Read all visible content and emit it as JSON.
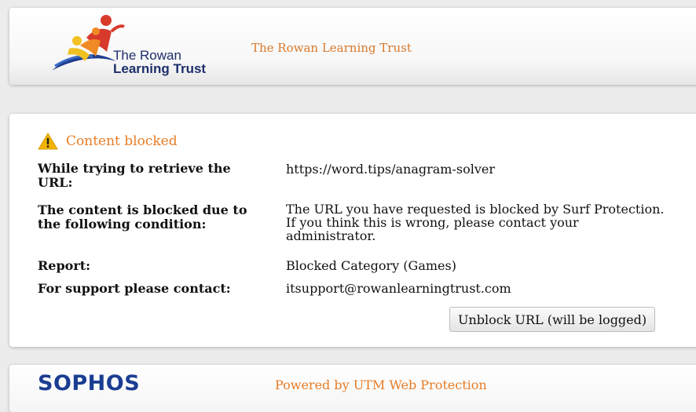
{
  "header": {
    "logo_line1": "The Rowan",
    "logo_line2": "Learning Trust",
    "org_name": "The Rowan Learning Trust"
  },
  "content": {
    "title": "Content blocked",
    "rows": [
      {
        "label": "While trying to retrieve the URL:",
        "value": "https://word.tips/anagram-solver"
      },
      {
        "label": "The content is blocked due to the following condition:",
        "value": "The URL you have requested is blocked by Surf Protection. If you think this is wrong, please contact your administrator."
      },
      {
        "label": "Report:",
        "value": "Blocked Category (Games)"
      },
      {
        "label": "For support please contact:",
        "value": "itsupport@rowanlearningtrust.com"
      }
    ],
    "unblock_label": "Unblock URL (will be logged)"
  },
  "footer": {
    "brand": "SOPHOS",
    "powered_by": "Powered by UTM Web Protection"
  },
  "colors": {
    "accent_orange": "#e77c26",
    "sophos_blue": "#1b3d92",
    "logo_navy": "#1e2f6b"
  },
  "icons": [
    "warning-icon",
    "rowan-logo-figure"
  ]
}
